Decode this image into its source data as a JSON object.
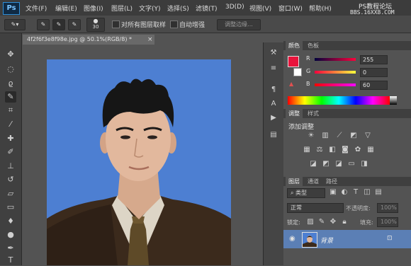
{
  "app": {
    "logo": "Ps",
    "menu": [
      "文件(F)",
      "编辑(E)",
      "图像(I)",
      "图层(L)",
      "文字(Y)",
      "选择(S)",
      "滤镜(T)",
      "3D(D)",
      "视图(V)",
      "窗口(W)",
      "帮助(H)"
    ],
    "watermark_line1": "PS教程论坛",
    "watermark_line2": "BBS.16XX8.COM"
  },
  "options_bar": {
    "brush_size": "30",
    "sample_all_layers": "对所有图层取样",
    "auto_enhance": "自动增强",
    "refine_edge": "调整边缘..."
  },
  "document": {
    "tab_title": "4f2f6f3e8f98e.jpg @ 50.1%(RGB/8) *",
    "close": "×"
  },
  "color_panel": {
    "tab_color": "颜色",
    "tab_swatches": "色板",
    "r_label": "R",
    "g_label": "G",
    "b_label": "B",
    "r_value": "255",
    "g_value": "0",
    "b_value": "60",
    "foreground": "#e8143c"
  },
  "adjustments_panel": {
    "tab_adjust": "调整",
    "tab_styles": "样式",
    "title": "添加调整"
  },
  "layers_panel": {
    "tab_layers": "图层",
    "tab_channels": "通道",
    "tab_paths": "路径",
    "kind": "类型",
    "blend_mode": "正常",
    "opacity_label": "不透明度:",
    "opacity_value": "100%",
    "lock_label": "锁定:",
    "fill_label": "填充:",
    "fill_value": "100%",
    "layer_name": "背景"
  }
}
